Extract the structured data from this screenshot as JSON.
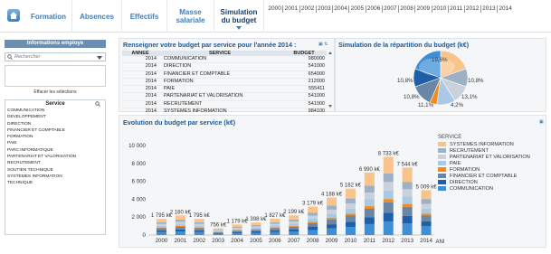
{
  "nav": {
    "tabs": [
      {
        "label": "Formation"
      },
      {
        "label": "Absences"
      },
      {
        "label": "Effectifs"
      },
      {
        "label": "Masse salariale"
      },
      {
        "label": "Simulation du budget"
      }
    ],
    "years": [
      "2000",
      "2001",
      "2002",
      "2003",
      "2004",
      "2005",
      "2006",
      "2007",
      "2008",
      "2009",
      "2010",
      "2011",
      "2012",
      "2013",
      "2014"
    ]
  },
  "left_panel": {
    "title": "Informations employe",
    "search_placeholder": "Rechercher",
    "clear_label": "Effacer les sélections",
    "service_title": "Service",
    "services": [
      "COMMUNICATION",
      "DEVELOPPEMENT",
      "DIRECTION",
      "FINANCIER ET COMPTABLE",
      "FORMATION",
      "PAIE",
      "PARC INFORMATIQUE",
      "PARTENARIAT ET VALORISATION",
      "RECRUTEMENT",
      "SOUTIEN TECHNIQUE",
      "SYSTEMES INFORMATION",
      "TECHNIQUE"
    ]
  },
  "budget_table": {
    "title": "Renseigner votre budget par service pour l'année 2014 :",
    "columns": [
      "ANNEE",
      "SERVICE",
      "BUDGET"
    ],
    "rows": [
      [
        "2014",
        "COMMUNICATION",
        "980000"
      ],
      [
        "2014",
        "DIRECTION",
        "541000"
      ],
      [
        "2014",
        "FINANCIER ET COMPTABLE",
        "654000"
      ],
      [
        "2014",
        "FORMATION",
        "212000"
      ],
      [
        "2014",
        "PAIE",
        "555411"
      ],
      [
        "2014",
        "PARTENARIAT ET VALORISATION",
        "541000"
      ],
      [
        "2014",
        "RECRUTEMENT",
        "541000"
      ],
      [
        "2014",
        "SYSTEMES INFORMATION",
        "984100"
      ]
    ]
  },
  "pie": {
    "title": "Simulation de la répartition du budget (k€)",
    "labels": [
      "19,6%",
      "10,8%",
      "13,1%",
      "4,2%",
      "11,1%",
      "10,8%",
      "10,8%",
      "19,6%"
    ]
  },
  "chart_data": [
    {
      "type": "pie",
      "title": "Simulation de la répartition du budget (k€)",
      "slices": [
        {
          "label": "SYSTEMES INFORMATION",
          "value": 19.6,
          "color": "#f8c48c"
        },
        {
          "label": "RECRUTEMENT",
          "value": 10.8,
          "color": "#9db0c4"
        },
        {
          "label": "PARTENARIAT ET VALORISATION",
          "value": 10.8,
          "color": "#c9d1da"
        },
        {
          "label": "PAIE",
          "value": 11.1,
          "color": "#a9c9e4"
        },
        {
          "label": "FORMATION",
          "value": 4.2,
          "color": "#f28a1e"
        },
        {
          "label": "FINANCIER ET COMPTABLE",
          "value": 13.1,
          "color": "#6a86a6"
        },
        {
          "label": "DIRECTION",
          "value": 10.8,
          "color": "#1f5fa8"
        },
        {
          "label": "COMMUNICATION",
          "value": 19.6,
          "color": "#3e8fd6"
        }
      ]
    },
    {
      "type": "bar",
      "stacked": true,
      "title": "Evolution du budget par service (k€)",
      "xlabel": "ANNEE",
      "ylim": [
        0,
        10000
      ],
      "yticks": [
        "0",
        "2 000",
        "4 000",
        "6 000",
        "8 000",
        "10 000"
      ],
      "categories": [
        "2000",
        "2001",
        "2002",
        "2003",
        "2004",
        "2005",
        "2006",
        "2007",
        "2008",
        "2009",
        "2010",
        "2011",
        "2012",
        "2013",
        "2014"
      ],
      "totals": [
        1795,
        2180,
        1795,
        756,
        1179,
        1398,
        1827,
        2199,
        3179,
        4188,
        5182,
        6990,
        8733,
        7544,
        5009
      ],
      "total_labels": [
        "1 795 k€",
        "2 180 k€",
        "1 795 k€",
        "756 k€",
        "1 179 k€",
        "1 398 k€",
        "1 827 k€",
        "2 199 k€",
        "3 179 k€",
        "4 188 k€",
        "5 182 k€",
        "6 990 k€",
        "8 733 k€",
        "7 544 k€",
        "5 009 k€"
      ],
      "series": [
        {
          "name": "COMMUNICATION",
          "color": "#3e8fd6",
          "values": [
            330,
            390,
            330,
            140,
            210,
            250,
            330,
            400,
            560,
            740,
            900,
            1220,
            1520,
            1310,
            980
          ]
        },
        {
          "name": "DIRECTION",
          "color": "#1f5fa8",
          "values": [
            200,
            240,
            200,
            80,
            130,
            160,
            200,
            240,
            350,
            460,
            580,
            780,
            970,
            840,
            541
          ]
        },
        {
          "name": "FINANCIER ET COMPTABLE",
          "color": "#6a86a6",
          "values": [
            230,
            280,
            230,
            100,
            150,
            180,
            240,
            290,
            420,
            550,
            690,
            930,
            1160,
            1000,
            654
          ]
        },
        {
          "name": "FORMATION",
          "color": "#f28a1e",
          "values": [
            80,
            100,
            80,
            30,
            50,
            60,
            80,
            100,
            140,
            180,
            220,
            290,
            370,
            320,
            212
          ]
        },
        {
          "name": "PAIE",
          "color": "#a9c9e4",
          "values": [
            200,
            240,
            200,
            85,
            130,
            155,
            200,
            240,
            350,
            460,
            570,
            770,
            960,
            830,
            555
          ]
        },
        {
          "name": "PARTENARIAT ET VALORISATION",
          "color": "#c9d1da",
          "values": [
            195,
            235,
            195,
            80,
            125,
            150,
            195,
            235,
            345,
            450,
            560,
            760,
            950,
            820,
            541
          ]
        },
        {
          "name": "RECRUTEMENT",
          "color": "#9db0c4",
          "values": [
            195,
            235,
            195,
            80,
            125,
            150,
            195,
            235,
            345,
            450,
            560,
            760,
            950,
            820,
            541
          ]
        },
        {
          "name": "SYSTEMES INFORMATION",
          "color": "#f8c48c",
          "values": [
            365,
            460,
            365,
            161,
            259,
            293,
            387,
            459,
            669,
            898,
            1102,
            1480,
            1853,
            1604,
            985
          ]
        }
      ],
      "legend_title": "SERVICE",
      "legend_order": [
        "SYSTEMES INFORMATION",
        "RECRUTEMENT",
        "PARTENARIAT ET VALORISATION",
        "PAIE",
        "FORMATION",
        "FINANCIER ET COMPTABLE",
        "DIRECTION",
        "COMMUNICATION"
      ]
    }
  ]
}
